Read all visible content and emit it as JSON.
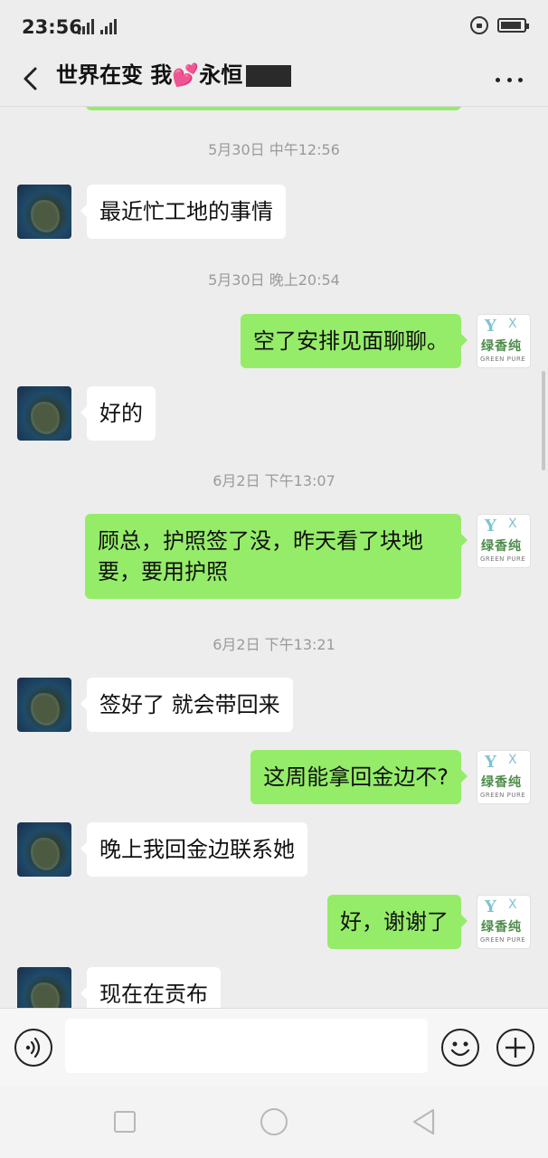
{
  "status_bar": {
    "time": "23:56",
    "network": "4G",
    "icons": [
      "signal-icon",
      "lock-rotation-icon",
      "battery-icon"
    ]
  },
  "header": {
    "title": "世界在变 我💕永恒",
    "back_icon": "chevron-left-icon",
    "more_icon": "more-dots-icon"
  },
  "contacts": {
    "left_avatar": "island-landscape-avatar",
    "right_avatar": {
      "mark": "Y",
      "mark_x": "X",
      "name_cn": "绿香纯",
      "name_en": "GREEN PURE"
    }
  },
  "chat": {
    "timestamps": [
      "5月30日 中午12:56",
      "5月30日 晚上20:54",
      "6月2日 下午13:07",
      "6月2日 下午13:21"
    ],
    "messages": [
      {
        "side": "left",
        "text": "最近忙工地的事情"
      },
      {
        "side": "right",
        "text": "空了安排见面聊聊。"
      },
      {
        "side": "left",
        "text": "好的"
      },
      {
        "side": "right",
        "text": "顾总，护照签了没，昨天看了块地要，要用护照"
      },
      {
        "side": "left",
        "text": "签好了 就会带回来"
      },
      {
        "side": "right",
        "text": "这周能拿回金边不?"
      },
      {
        "side": "left",
        "text": "晚上我回金边联系她"
      },
      {
        "side": "right",
        "text": "好，谢谢了"
      },
      {
        "side": "left",
        "text": "现在在贡布"
      }
    ]
  },
  "input_bar": {
    "value": "",
    "placeholder": "",
    "voice_icon": "voice-icon",
    "emoji_icon": "emoji-icon",
    "plus_icon": "plus-icon"
  },
  "system_nav": {
    "buttons": [
      "recent-apps-icon",
      "home-icon",
      "back-triangle-icon"
    ]
  },
  "colors": {
    "background": "#ededed",
    "bubble_sent": "#95ec69",
    "bubble_received": "#ffffff",
    "timestamp_text": "#9a9a9a"
  }
}
